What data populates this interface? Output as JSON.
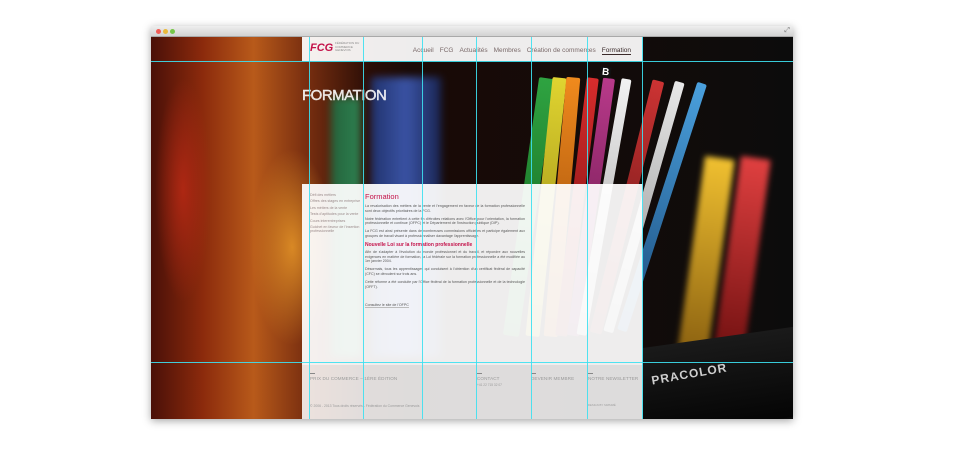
{
  "window": {
    "traffic_lights": [
      "close",
      "minimize",
      "zoom"
    ],
    "fullscreen_icon": "fullscreen-icon"
  },
  "header": {
    "logo_mark": "FCG",
    "logo_text": "FÉDÉRATION DU COMMERCE GENEVOIS",
    "nav": [
      {
        "label": "Accueil",
        "active": false
      },
      {
        "label": "FCG",
        "active": false
      },
      {
        "label": "Actualités",
        "active": false
      },
      {
        "label": "Membres",
        "active": false
      },
      {
        "label": "Création de commerces",
        "active": false
      },
      {
        "label": "Formation",
        "active": true
      }
    ]
  },
  "page_heading": "FORMATION",
  "sidebar": {
    "items": [
      "Défi des métiers",
      "Offres des stages en entreprise",
      "Les métiers de la vente",
      "Tests d'aptitudes pour la vente",
      "Cours interentreprises",
      "Guichet en faveur de l'insertion professionnelle"
    ]
  },
  "main": {
    "title": "Formation",
    "p1": "La revalorisation des métiers de la vente et l'engagement en faveur de la formation professionnelle sont deux objectifs prioritaires de la FCG.",
    "p2": "Notre fédération entretient à cette fin d'étroites relations avec l'Office pour l'orientation, la formation professionnelle et continue (OFPC) et le Département de l'instruction publique (DIP).",
    "p3": "La FCG est ainsi présente dans de nombreuses commissions officielles et participe également aux groupes de travail visant à professionnaliser davantage l'apprentissage.",
    "subtitle": "Nouvelle Loi sur la formation professionnelle",
    "p4": "Afin de s'adapter à l'évolution du monde professionnel et du travail, et répondre aux nouvelles exigences en matière de formation, la Loi fédérale sur la formation professionnelle a été modifiée au 1er janvier 2004.",
    "p5": "Désormais, tous les apprentissages qui conduisent à l'obtention d'un certificat fédéral de capacité (CFC) se déroulent sur trois ans.",
    "p6": "Cette réforme a été conduite par l'Office fédéral de la formation professionnelle et de la technologie (OFFT).",
    "link": "Consultez le site de l'OFPC"
  },
  "footer": {
    "col1_title": "PRIX DU COMMERCE – 1ÈRE ÉDITION",
    "col2_title": "CONTACT",
    "col2_sub": "+41 22 715 32 07",
    "col3_title": "DEVENIR MEMBRE",
    "col4_title": "NOTRE NEWSLETTER",
    "copyright": "© 2006 - 2013 Tous droits réservés - Fédération du Commerce Genevois",
    "design": "DESIGN BY SIMSIMÉ"
  },
  "background": {
    "shelf_text": "PRACOLOR",
    "spine_letter": "B"
  },
  "colors": {
    "accent": "#c4124a",
    "guide": "#3de0f0",
    "panel": "#ffffff"
  }
}
